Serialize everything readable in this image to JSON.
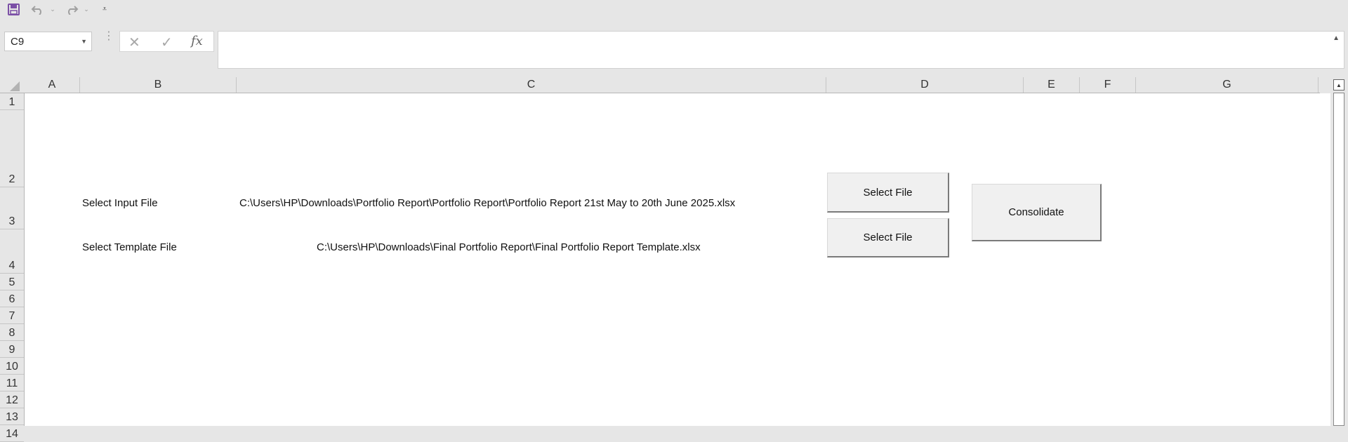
{
  "toolbar": {
    "save_icon": "save-icon",
    "undo_icon": "undo-icon",
    "redo_icon": "redo-icon",
    "customize_icon": "customize-qat-icon"
  },
  "namebox": {
    "value": "C9"
  },
  "formula_bar": {
    "value": "",
    "fx_label": "fx"
  },
  "columns": [
    "A",
    "B",
    "C",
    "D",
    "E",
    "F",
    "G"
  ],
  "rows": [
    "1",
    "2",
    "3",
    "4",
    "5",
    "6",
    "7",
    "8",
    "9",
    "10",
    "11",
    "12",
    "13",
    "14"
  ],
  "cells": {
    "b3": "Select Input File",
    "c3": "C:\\Users\\HP\\Downloads\\Portfolio Report\\Portfolio Report\\Portfolio Report 21st May to 20th June 2025.xlsx",
    "b4": "Select Template File",
    "c4": "C:\\Users\\HP\\Downloads\\Final Portfolio Report\\Final Portfolio Report Template.xlsx"
  },
  "buttons": {
    "select_input": "Select File",
    "select_template": "Select File",
    "consolidate": "Consolidate"
  },
  "colors": {
    "save_icon": "#7b4fa6",
    "grid_bg": "#ffffff",
    "chrome_bg": "#e6e6e6"
  }
}
